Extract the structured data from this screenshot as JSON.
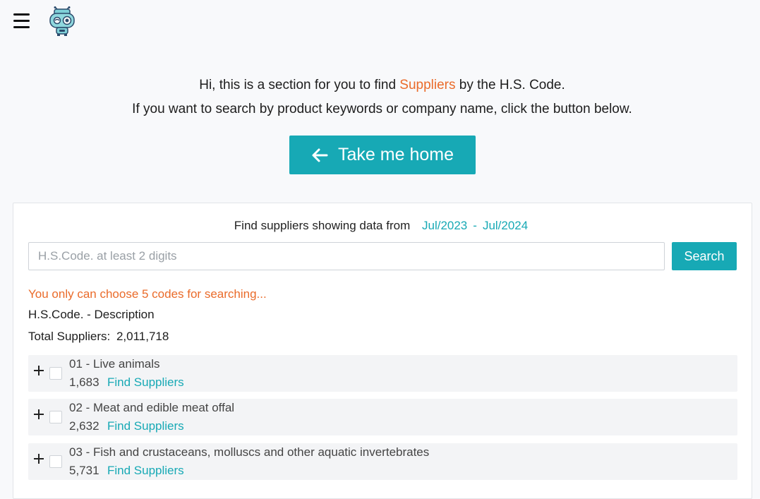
{
  "header": {
    "menu_icon": "hamburger-icon",
    "logo_icon": "robot-mascot-logo"
  },
  "intro": {
    "line1_prefix": "Hi, this is a section for you to find",
    "line1_highlight": "Suppliers",
    "line1_suffix": "by the H.S. Code.",
    "line2": "If you want to search by product keywords or company name, click the button below.",
    "highlight_color": "#ea6b2a"
  },
  "home_button": {
    "label": "Take me home",
    "icon": "arrow-left-icon",
    "color": "#17a9b5"
  },
  "search": {
    "range_label": "Find suppliers showing data from",
    "date_from": "Jul/2023",
    "date_separator": "-",
    "date_to": "Jul/2024",
    "placeholder": "H.S.Code. at least 2 digits",
    "value": "",
    "button_label": "Search"
  },
  "notice": "You only can choose 5 codes for searching...",
  "list_header": "H.S.Code. - Description",
  "total": {
    "label": "Total Suppliers:",
    "value": "2,011,718"
  },
  "codes": [
    {
      "title": "01 - Live animals",
      "count": "1,683",
      "link": "Find Suppliers"
    },
    {
      "title": "02 - Meat and edible meat offal",
      "count": "2,632",
      "link": "Find Suppliers"
    },
    {
      "title": "03 - Fish and crustaceans, molluscs and other aquatic invertebrates",
      "count": "5,731",
      "link": "Find Suppliers"
    }
  ]
}
